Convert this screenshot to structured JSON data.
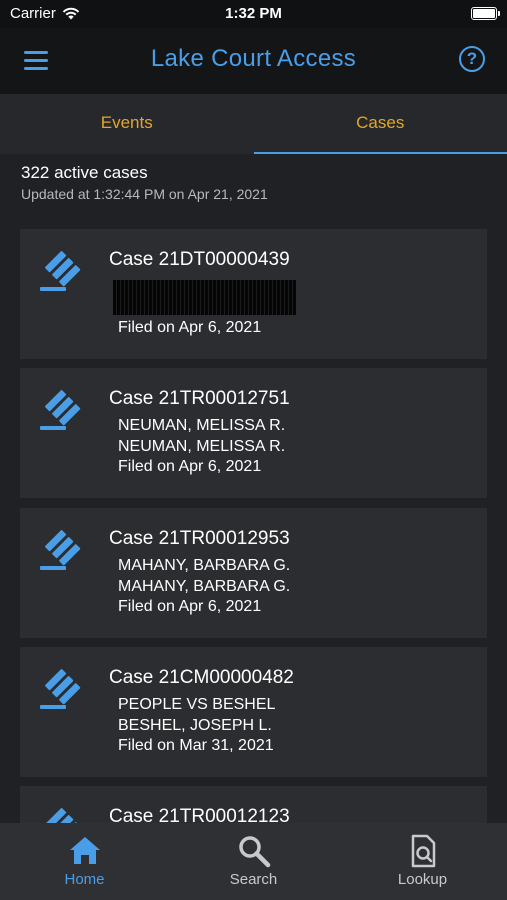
{
  "status_bar": {
    "carrier": "Carrier",
    "time": "1:32 PM"
  },
  "header": {
    "title": "Lake Court Access",
    "menu_icon": "hamburger-menu-icon",
    "help_icon": "help-circle-icon",
    "help_glyph": "?"
  },
  "tabs": [
    {
      "label": "Events",
      "active": false
    },
    {
      "label": "Cases",
      "active": true
    }
  ],
  "summary": {
    "count_text": "322 active cases",
    "updated_text": "Updated at 1:32:44 PM on Apr 21, 2021"
  },
  "cases": [
    {
      "title": "Case 21DT00000439",
      "party1": "",
      "party2": "",
      "filed": "Filed on Apr 6, 2021",
      "redacted": true
    },
    {
      "title": "Case 21TR00012751",
      "party1": "NEUMAN, MELISSA R.",
      "party2": "NEUMAN, MELISSA R.",
      "filed": "Filed on Apr 6, 2021"
    },
    {
      "title": "Case 21TR00012953",
      "party1": "MAHANY, BARBARA G.",
      "party2": "MAHANY, BARBARA G.",
      "filed": "Filed on Apr 6, 2021"
    },
    {
      "title": "Case 21CM00000482",
      "party1": "PEOPLE VS BESHEL",
      "party2": "BESHEL, JOSEPH L.",
      "filed": "Filed on Mar 31, 2021"
    },
    {
      "title": "Case 21TR00012123",
      "party1": "",
      "party2": "",
      "filed": ""
    }
  ],
  "bottom_nav": [
    {
      "label": "Home",
      "icon": "home-icon",
      "active": true
    },
    {
      "label": "Search",
      "icon": "search-icon",
      "active": false
    },
    {
      "label": "Lookup",
      "icon": "document-search-icon",
      "active": false
    }
  ],
  "colors": {
    "accent_blue": "#4a9ee8",
    "tab_gold": "#e3a62a",
    "background": "#1f2124",
    "card": "#2b2d30"
  }
}
